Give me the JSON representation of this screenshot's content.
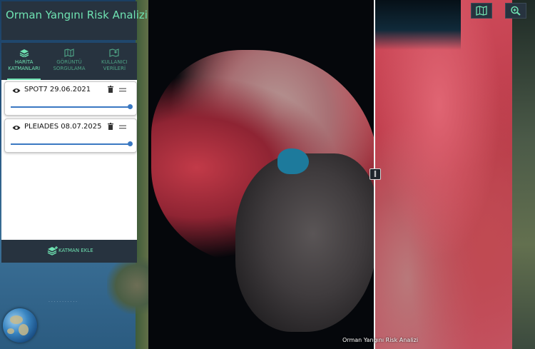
{
  "app": {
    "title": "Orman Yangını Risk Analizi"
  },
  "tabs": [
    {
      "label_line1": "HARİTA",
      "label_line2": "KATMANLARI",
      "icon": "layers-icon",
      "active": true
    },
    {
      "label_line1": "GÖRÜNTÜ",
      "label_line2": "SORGULAMA",
      "icon": "map-icon",
      "active": false
    },
    {
      "label_line1": "KULLANICI",
      "label_line2": "VERİLERİ",
      "icon": "user-data-icon",
      "active": false
    }
  ],
  "layers": [
    {
      "name": "SPOT7 29.06.2021",
      "opacity": 1.0
    },
    {
      "name": "PLEIADES 08.07.2025",
      "opacity": 1.0
    }
  ],
  "add_layer": {
    "label": "KATMAN EKLE",
    "icon": "add-layer-icon"
  },
  "toolbar": {
    "map_button_icon": "map-icon",
    "zoom_button_icon": "zoom-icon"
  },
  "map": {
    "attribution": "Orman Yangını Risk Analizi",
    "left_watermark": "· · · · · · · · · · ·"
  },
  "colors": {
    "panel_bg": "#27333f",
    "accent": "#6fe3b2",
    "slider": "#3a78c2"
  }
}
